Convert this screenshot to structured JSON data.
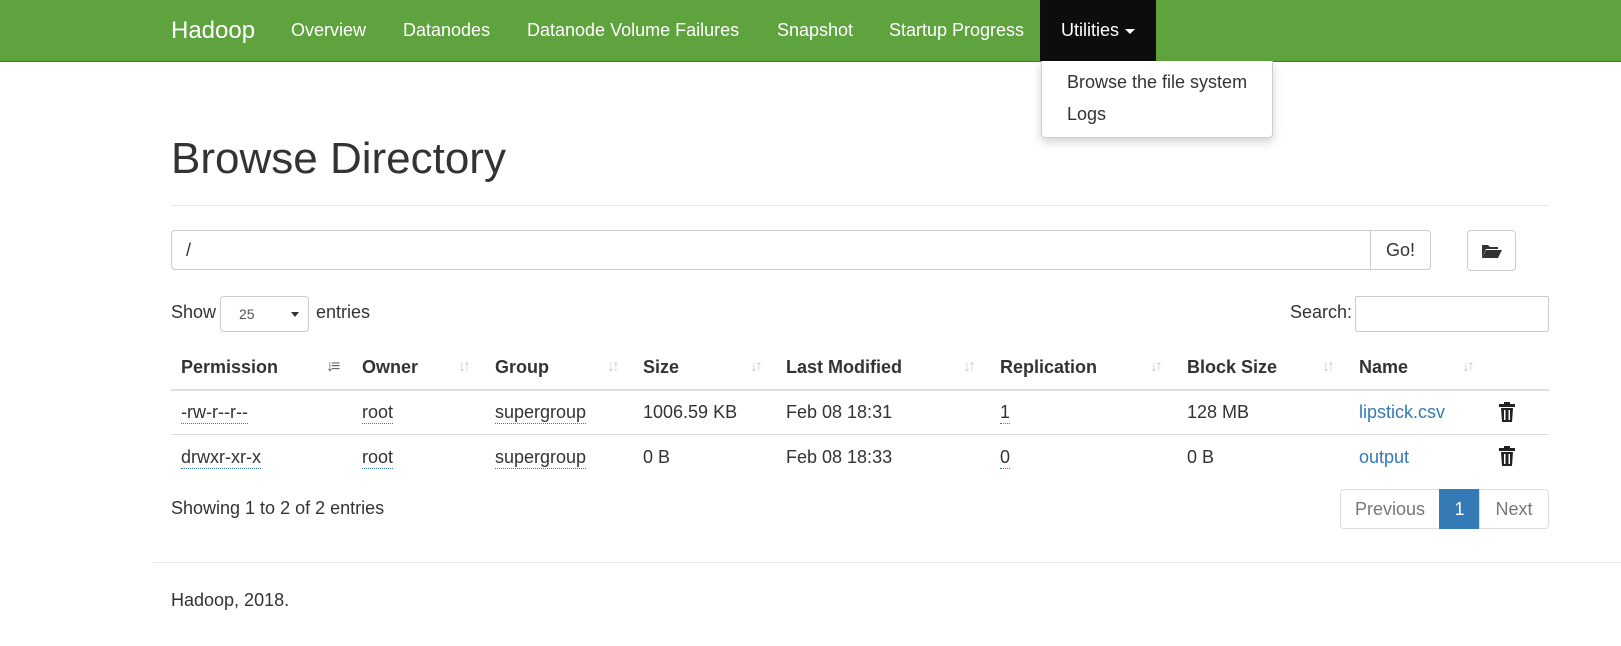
{
  "navbar": {
    "brand": "Hadoop",
    "items": [
      {
        "label": "Overview"
      },
      {
        "label": "Datanodes"
      },
      {
        "label": "Datanode Volume Failures"
      },
      {
        "label": "Snapshot"
      },
      {
        "label": "Startup Progress"
      },
      {
        "label": "Utilities"
      }
    ],
    "dropdown": [
      "Browse the file system",
      "Logs"
    ]
  },
  "page_title": "Browse Directory",
  "path": {
    "value": "/",
    "go_label": "Go!",
    "folder_icon": "folder-open-icon"
  },
  "entries": {
    "show_label": "Show",
    "selected": "25",
    "suffix": "entries"
  },
  "search": {
    "label": "Search:",
    "value": ""
  },
  "table": {
    "columns": [
      "Permission",
      "Owner",
      "Group",
      "Size",
      "Last Modified",
      "Replication",
      "Block Size",
      "Name"
    ],
    "rows": [
      {
        "permission": "-rw-r--r--",
        "owner": "root",
        "group": "supergroup",
        "size": "1006.59 KB",
        "modified": "Feb 08 18:31",
        "replication": "1",
        "block_size": "128 MB",
        "name": "lipstick.csv"
      },
      {
        "permission": "drwxr-xr-x",
        "owner": "root",
        "group": "supergroup",
        "size": "0 B",
        "modified": "Feb 08 18:33",
        "replication": "0",
        "block_size": "0 B",
        "name": "output"
      }
    ]
  },
  "pagination": {
    "info": "Showing 1 to 2 of 2 entries",
    "previous": "Previous",
    "current": "1",
    "next": "Next"
  },
  "footer": "Hadoop, 2018.",
  "colors": {
    "navbar": "#5fa33e",
    "active_nav": "#0d0d0d",
    "link": "#337ab7"
  }
}
